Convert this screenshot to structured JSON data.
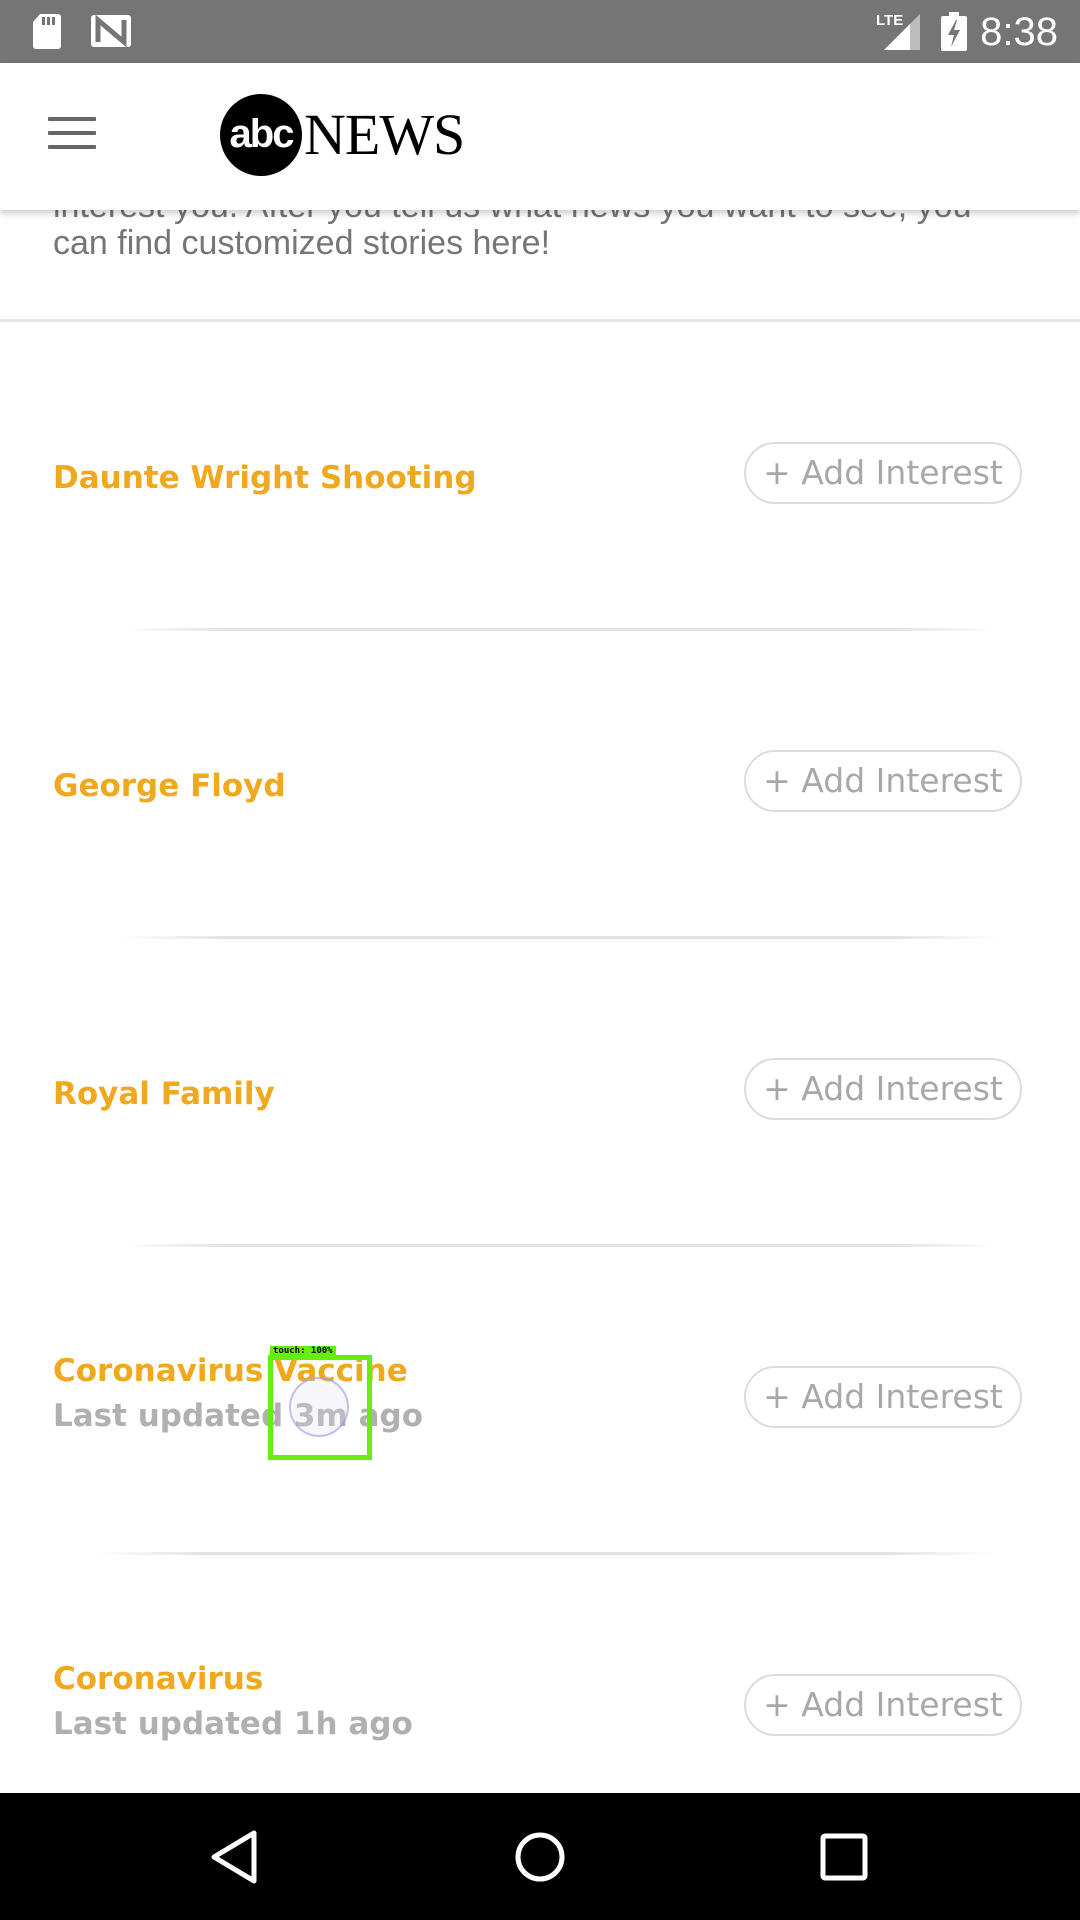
{
  "status_bar": {
    "time": "8:38",
    "network": "LTE",
    "icons": [
      "sd-card-icon",
      "n-notification-icon",
      "lte-signal-icon",
      "battery-charging-icon"
    ]
  },
  "header": {
    "logo_circle_text": "abc",
    "logo_word": "NEWS",
    "menu_icon": "hamburger-menu-icon"
  },
  "intro": {
    "text": "interest you. After you tell us what news you want to see, you can find customized stories here!"
  },
  "topics": [
    {
      "title": "Daunte Wright Shooting",
      "updated": "",
      "button_label": "+ Add Interest"
    },
    {
      "title": "George Floyd",
      "updated": "",
      "button_label": "+ Add Interest"
    },
    {
      "title": "Royal Family",
      "updated": "",
      "button_label": "+ Add Interest"
    },
    {
      "title": "Coronavirus Vaccine",
      "updated": "Last updated 3m ago",
      "button_label": "+ Add Interest"
    },
    {
      "title": "Coronavirus",
      "updated": "Last updated 1h ago",
      "button_label": "+ Add Interest"
    }
  ],
  "touch_indicator": {
    "label": "touch: 100%"
  },
  "colors": {
    "accent": "#f0a81e",
    "status_bar": "#757575",
    "nav_bar": "#000000",
    "button_text": "#a8a8a8",
    "touch_overlay": "#66ee11"
  },
  "nav_bar": {
    "icons": [
      "back-icon",
      "home-icon",
      "recents-icon"
    ]
  }
}
